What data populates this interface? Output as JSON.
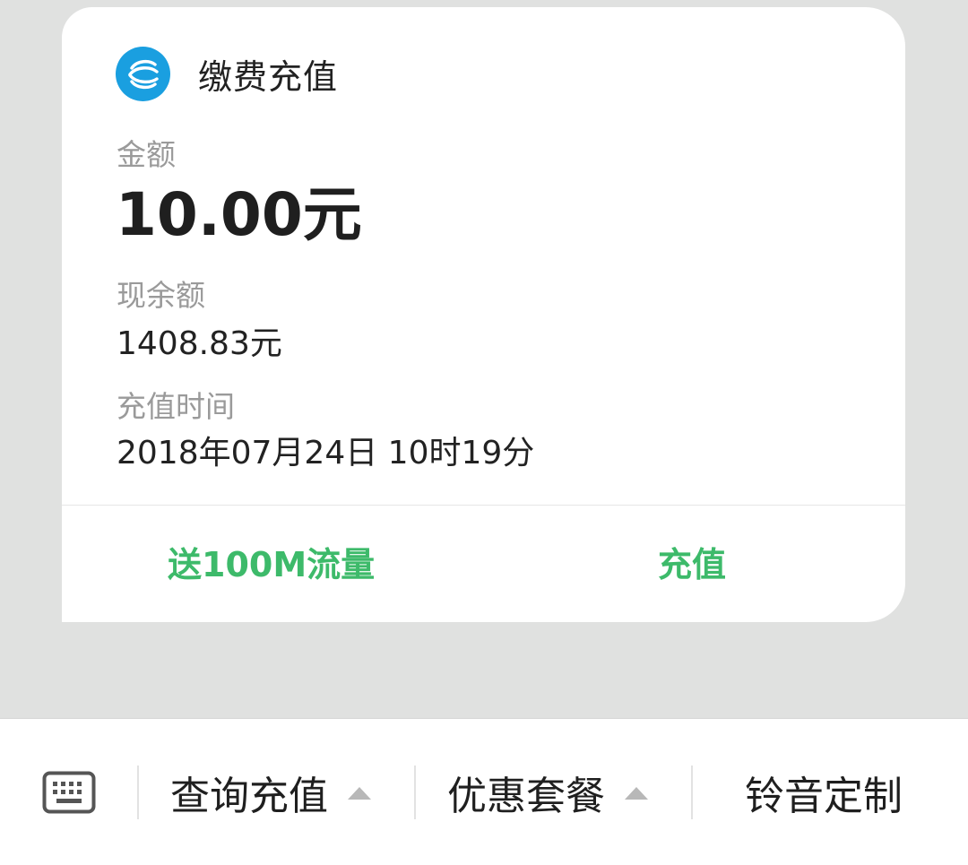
{
  "card": {
    "title": "缴费充值",
    "logo_icon": "china-mobile-logo",
    "amount_label": "金额",
    "amount_value": "10.00元",
    "balance_label": "现余额",
    "balance_value": "1408.83元",
    "time_label": "充值时间",
    "time_value": "2018年07月24日 10时19分",
    "actions": [
      {
        "label": "送100M流量"
      },
      {
        "label": "充值"
      }
    ]
  },
  "bottom_bar": {
    "keyboard_icon": "keyboard-icon",
    "items": [
      {
        "label": "查询充值",
        "has_submenu": true
      },
      {
        "label": "优惠套餐",
        "has_submenu": true
      },
      {
        "label": "铃音定制",
        "has_submenu": false
      }
    ]
  },
  "colors": {
    "background": "#e0e1e0",
    "card": "#ffffff",
    "accent_green": "#3dba6a",
    "logo_blue": "#1a9fe0",
    "muted_label": "#9a9a9a"
  }
}
